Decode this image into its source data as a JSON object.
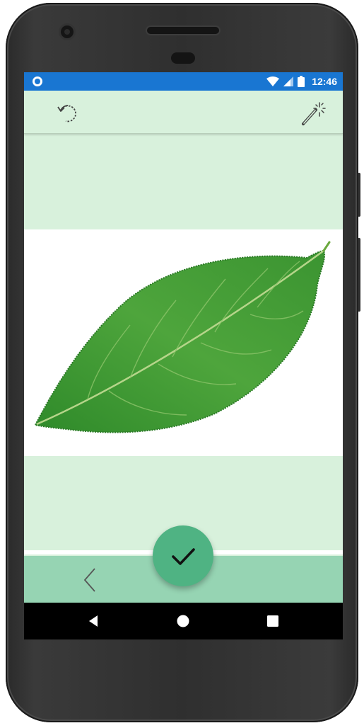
{
  "status_bar": {
    "time": "12:46",
    "icons": [
      "sync-circle-icon",
      "wifi-icon",
      "cell-signal-icon",
      "battery-icon"
    ]
  },
  "toolbar": {
    "left_icon": "undo-icon",
    "right_icon": "magic-wand-icon"
  },
  "image": {
    "subject": "leaf"
  },
  "actions": {
    "confirm_icon": "checkmark-icon",
    "back_icon": "chevron-left-icon"
  },
  "navigation": {
    "buttons": [
      "back-triangle-icon",
      "home-circle-icon",
      "recents-square-icon"
    ]
  },
  "colors": {
    "status_bar": "#1976d2",
    "background": "#d8f1dc",
    "bottom_bar": "#96d4b3",
    "fab": "#4fb383"
  }
}
